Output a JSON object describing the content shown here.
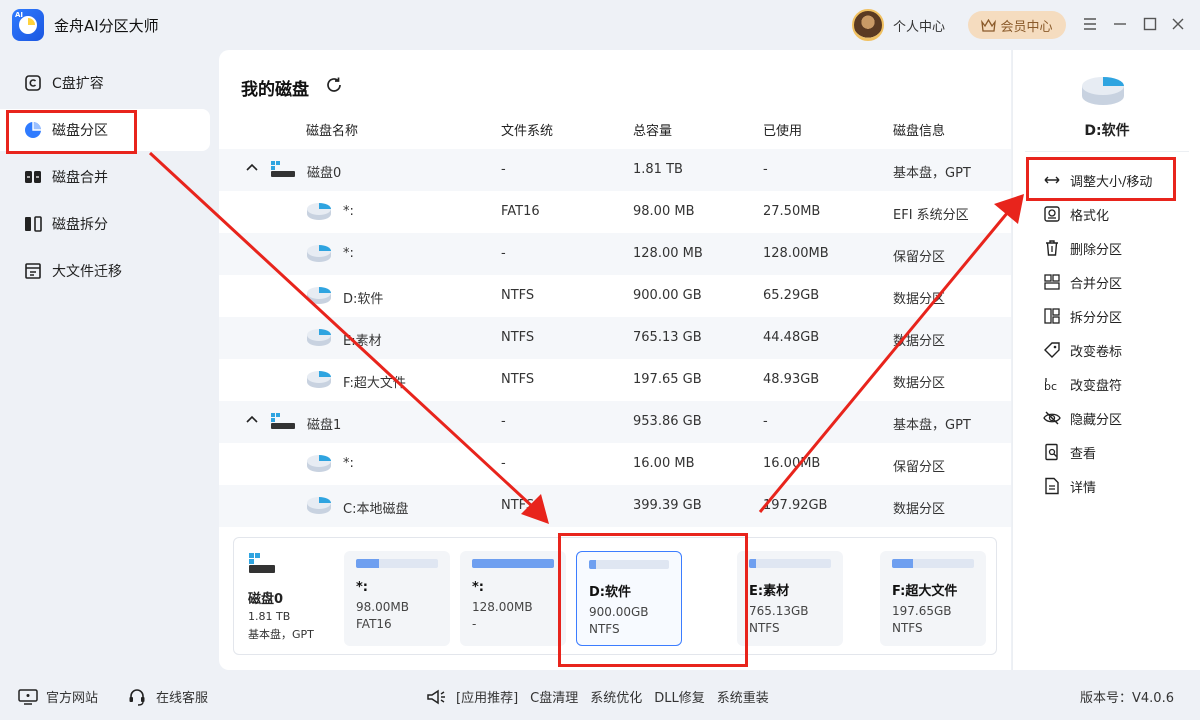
{
  "app": {
    "title": "金舟AI分区大师",
    "logo_text": "AI"
  },
  "header": {
    "user_center": "个人中心",
    "vip": "会员中心"
  },
  "sidebar": {
    "items": [
      {
        "label": "C盘扩容",
        "icon": "c-drive-icon"
      },
      {
        "label": "磁盘分区",
        "icon": "pie-partition-icon",
        "active": true
      },
      {
        "label": "磁盘合并",
        "icon": "merge-disk-icon"
      },
      {
        "label": "磁盘拆分",
        "icon": "split-disk-icon"
      },
      {
        "label": "大文件迁移",
        "icon": "file-migrate-icon"
      }
    ]
  },
  "main": {
    "title": "我的磁盘",
    "columns": [
      "磁盘名称",
      "文件系统",
      "总容量",
      "已使用",
      "磁盘信息"
    ],
    "rows": [
      {
        "type": "disk",
        "name": "磁盘0",
        "fs": "-",
        "total": "1.81 TB",
        "used": "-",
        "info": "基本盘，GPT"
      },
      {
        "type": "part",
        "name": "*:",
        "fs": "FAT16",
        "total": "98.00 MB",
        "used": "27.50MB",
        "info": "EFI 系统分区"
      },
      {
        "type": "part",
        "name": "*:",
        "fs": "-",
        "total": "128.00 MB",
        "used": "128.00MB",
        "info": "保留分区"
      },
      {
        "type": "part",
        "name": "D:软件",
        "fs": "NTFS",
        "total": "900.00 GB",
        "used": "65.29GB",
        "info": "数据分区",
        "selected": true
      },
      {
        "type": "part",
        "name": "E:素材",
        "fs": "NTFS",
        "total": "765.13 GB",
        "used": "44.48GB",
        "info": "数据分区"
      },
      {
        "type": "part",
        "name": "F:超大文件",
        "fs": "NTFS",
        "total": "197.65 GB",
        "used": "48.93GB",
        "info": "数据分区"
      },
      {
        "type": "disk",
        "name": "磁盘1",
        "fs": "-",
        "total": "953.86 GB",
        "used": "-",
        "info": "基本盘，GPT"
      },
      {
        "type": "part",
        "name": "*:",
        "fs": "-",
        "total": "16.00 MB",
        "used": "16.00MB",
        "info": "保留分区"
      },
      {
        "type": "part",
        "name": "C:本地磁盘",
        "fs": "NTFS",
        "total": "399.39 GB",
        "used": "197.92GB",
        "info": "数据分区"
      }
    ]
  },
  "map": {
    "disk": {
      "name": "磁盘0",
      "size": "1.81 TB",
      "info": "基本盘，GPT"
    },
    "cards": [
      {
        "name": "*:",
        "size": "98.00MB",
        "fs": "FAT16",
        "usage": 0.28
      },
      {
        "name": "*:",
        "size": "128.00MB",
        "fs": "-",
        "usage": 1.0
      },
      {
        "name": "D:软件",
        "size": "900.00GB",
        "fs": "NTFS",
        "usage": 0.07,
        "selected": true
      },
      {
        "name": "E:素材",
        "size": "765.13GB",
        "fs": "NTFS",
        "usage": 0.06
      },
      {
        "name": "F:超大文件",
        "size": "197.65GB",
        "fs": "NTFS",
        "usage": 0.25
      }
    ]
  },
  "right": {
    "selected_name": "D:软件",
    "actions": [
      {
        "label": "调整大小/移动",
        "icon": "resize-move-icon"
      },
      {
        "label": "格式化",
        "icon": "format-icon"
      },
      {
        "label": "删除分区",
        "icon": "trash-icon"
      },
      {
        "label": "合并分区",
        "icon": "merge-partition-icon"
      },
      {
        "label": "拆分分区",
        "icon": "split-partition-icon"
      },
      {
        "label": "改变卷标",
        "icon": "label-tag-icon"
      },
      {
        "label": "改变盘符",
        "icon": "drive-letter-icon"
      },
      {
        "label": "隐藏分区",
        "icon": "eye-hidden-icon"
      },
      {
        "label": "查看",
        "icon": "view-doc-icon"
      },
      {
        "label": "详情",
        "icon": "details-doc-icon"
      }
    ]
  },
  "footer": {
    "website": "官方网站",
    "support": "在线客服",
    "recommend": "[应用推荐]",
    "links": [
      "C盘清理",
      "系统优化",
      "DLL修复",
      "系统重装"
    ],
    "version": "版本号：V4.0.6"
  },
  "colors": {
    "accent": "#3c7dff",
    "annotation": "#e8241c",
    "vip_bg": "#f5dcbf"
  }
}
